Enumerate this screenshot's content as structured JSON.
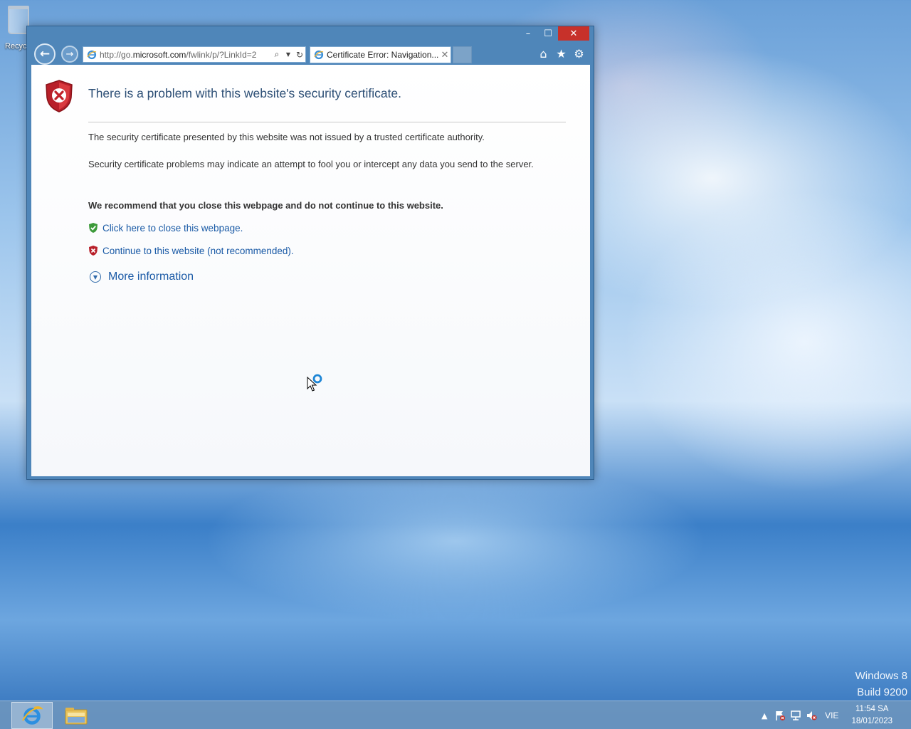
{
  "desktop": {
    "recycle_bin_label": "Recyc",
    "watermark": {
      "line1": "Windows 8",
      "line2": "Build 9200"
    }
  },
  "window": {
    "controls": {
      "minimize": "–",
      "maximize": "☐",
      "close": "✕"
    },
    "address": {
      "url_prefix": "http://go.",
      "url_domain": "microsoft.com",
      "url_rest": "/fwlink/p/?LinkId=2"
    },
    "tab": {
      "title": "Certificate Error: Navigation...",
      "close": "✕"
    },
    "command_icons": [
      "home-icon",
      "favorites-icon",
      "tools-gear-icon"
    ]
  },
  "page": {
    "title": "There is a problem with this website's security certificate.",
    "para1": "The security certificate presented by this website was not issued by a trusted certificate authority.",
    "para2": "Security certificate problems may indicate an attempt to fool you or intercept any data you send to the server.",
    "recommendation": "We recommend that you close this webpage and do not continue to this website.",
    "close_link": "Click here to close this webpage.",
    "continue_link": "Continue to this website (not recommended).",
    "more_info": "More information"
  },
  "taskbar": {
    "apps": [
      "internet-explorer",
      "file-explorer"
    ],
    "tray": {
      "language": "VIE",
      "time": "11:54 SA",
      "date": "18/01/2023"
    }
  },
  "colors": {
    "window_frame": "#4f86b9",
    "close_button": "#c7312a",
    "title_text": "#2d4f76",
    "link": "#1a5aa6"
  }
}
